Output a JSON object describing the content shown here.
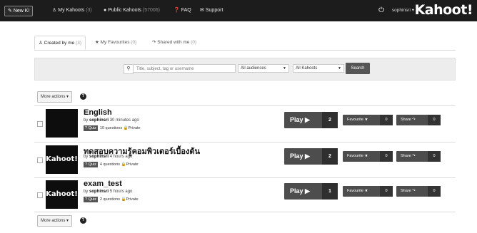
{
  "topbar": {
    "new_label": "New K!",
    "nav": [
      {
        "label": "My Kahoots",
        "count": "(3)",
        "icon": "user-icon"
      },
      {
        "label": "Public Kahoots",
        "count": "(57006)",
        "icon": "globe-icon"
      },
      {
        "label": "FAQ",
        "count": "",
        "icon": "help-icon"
      },
      {
        "label": "Support",
        "count": "",
        "icon": "chat-icon"
      }
    ],
    "user": "sophinsri",
    "logo": "Kahoot!"
  },
  "tabs": [
    {
      "label": "Created by me",
      "count": "(3)"
    },
    {
      "label": "My Favourites",
      "count": "(0)"
    },
    {
      "label": "Shared with me",
      "count": "(0)"
    }
  ],
  "search": {
    "placeholder": "Title, subject, tag or username",
    "audience": "All audiences",
    "type": "All Kahoots",
    "button": "Search"
  },
  "actions": {
    "more_label": "More actions",
    "info": "?"
  },
  "kahoots": [
    {
      "title": "English",
      "owner": "sophinsri",
      "time": "30 minutes ago",
      "badge": "Quiz",
      "questions": "10 questions",
      "visibility": "Private",
      "play": "Play",
      "plays": "2",
      "favourite": "Favourite",
      "fav_count": "0",
      "share": "Share",
      "share_count": "0",
      "thumb": ""
    },
    {
      "title": "ทดสอบความรู้คอมพิวเตอร์เบื้องต้น",
      "owner": "sophinsri",
      "time": "4 hours ago",
      "badge": "Quiz",
      "questions": "4 questions",
      "visibility": "Private",
      "play": "Play",
      "plays": "2",
      "favourite": "Favourite",
      "fav_count": "0",
      "share": "Share",
      "share_count": "0",
      "thumb": "Kahoot!"
    },
    {
      "title": "exam_test",
      "owner": "sophinsri",
      "time": "5 hours ago",
      "badge": "Quiz",
      "questions": "2 questions",
      "visibility": "Private",
      "play": "Play",
      "plays": "1",
      "favourite": "Favourite",
      "fav_count": "0",
      "share": "Share",
      "share_count": "0",
      "thumb": "Kahoot!"
    }
  ]
}
